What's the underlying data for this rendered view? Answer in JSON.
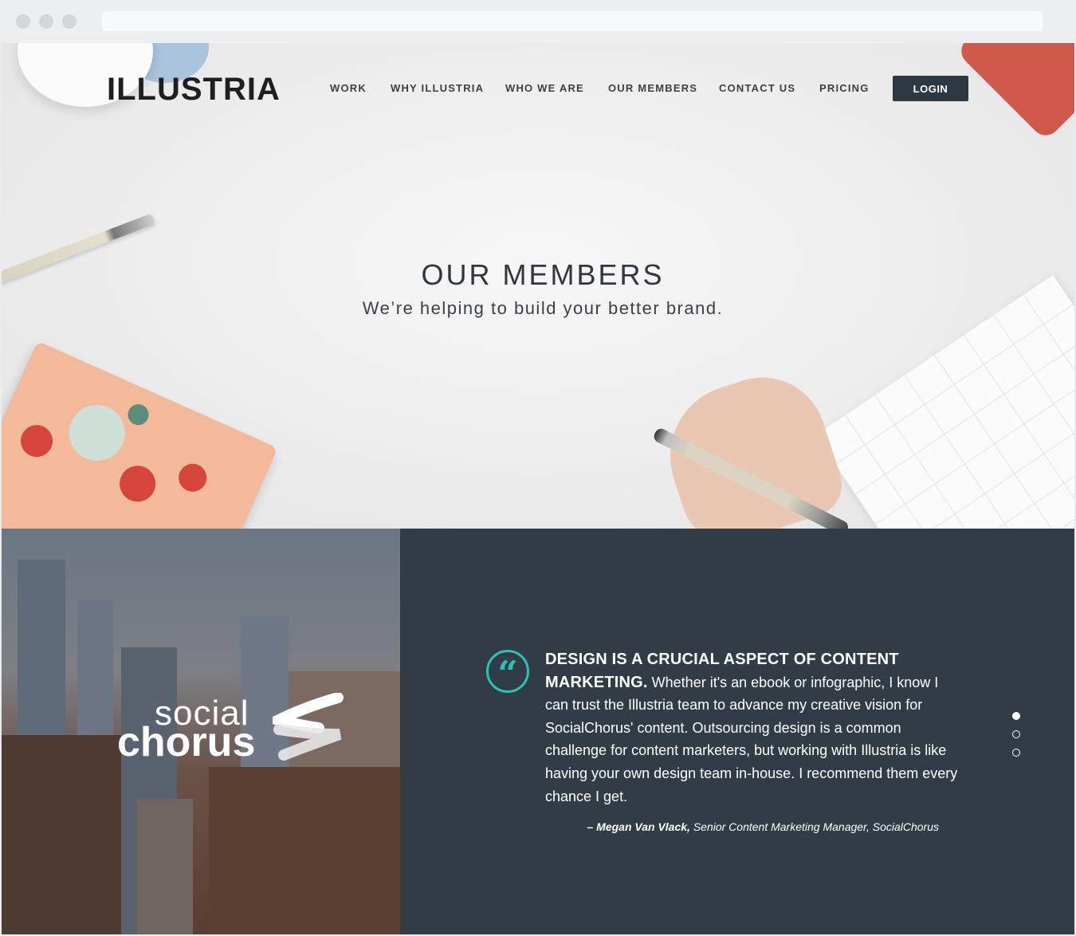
{
  "brand": {
    "logo": "ILLUSTRIA"
  },
  "nav": {
    "items": [
      "WORK",
      "WHY ILLUSTRIA",
      "WHO WE ARE",
      "OUR MEMBERS",
      "CONTACT US",
      "PRICING"
    ],
    "login_label": "LOGIN"
  },
  "hero": {
    "title": "OUR MEMBERS",
    "subtitle": "We’re helping to build your better brand."
  },
  "testimonial": {
    "client_logo": {
      "word1": "social",
      "word2": "chorus"
    },
    "quote_lead": "DESIGN IS A CRUCIAL ASPECT OF CONTENT MARKETING.",
    "quote_body": " Whether it's an ebook or infographic, I know I can trust the Illustria team to advance my creative vision for SocialChorus' content. Outsourcing design is a common challenge for content marketers, but working with Illustria is like having your own design team in-house. I recommend them every chance I get.",
    "author": "– Megan Van Vlack,",
    "author_title": " Senior Content Marketing Manager, SocialChorus",
    "slides": {
      "count": 3,
      "active": 1
    },
    "accent_color": "#2bc2b5",
    "background_color": "#323c47"
  },
  "icons": {
    "quote": "“"
  }
}
